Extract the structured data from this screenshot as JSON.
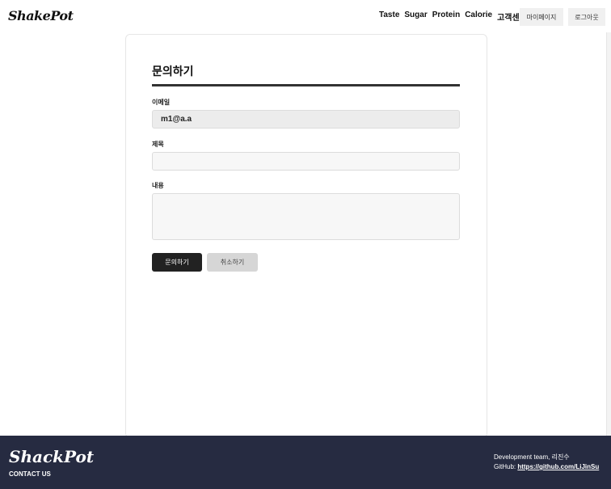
{
  "header": {
    "logo": "ShakePot",
    "nav": [
      "Taste",
      "Sugar",
      "Protein",
      "Calorie",
      "고객센터"
    ],
    "mypage_label": "마이페이지",
    "logout_label": "로그아웃"
  },
  "form": {
    "title": "문의하기",
    "email_label": "이메일",
    "email_value": "m1@a.a",
    "subject_label": "제목",
    "subject_value": "",
    "content_label": "내용",
    "content_value": "",
    "submit_label": "문의하기",
    "cancel_label": "취소하기"
  },
  "footer": {
    "logo": "ShackPot",
    "contact": "CONTACT US",
    "team": "Development team, 리진수",
    "github_prefix": "GitHub: ",
    "github_link": "https://github.com/LiJinSu"
  },
  "colors": {
    "footer_bg": "#262b41",
    "primary_button": "#222222",
    "secondary_button": "#d6d6d6"
  }
}
